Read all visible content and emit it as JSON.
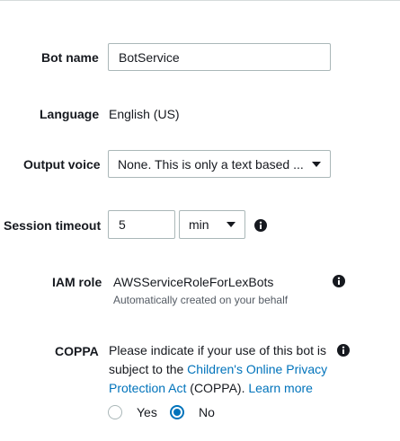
{
  "form": {
    "bot_name": {
      "label": "Bot name",
      "value": "BotService"
    },
    "language": {
      "label": "Language",
      "value": "English (US)"
    },
    "output_voice": {
      "label": "Output voice",
      "value": "None. This is only a text based ..."
    },
    "session_timeout": {
      "label": "Session timeout",
      "value": "5",
      "unit": "min"
    },
    "iam_role": {
      "label": "IAM role",
      "value": "AWSServiceRoleForLexBots",
      "sub": "Automatically created on your behalf"
    },
    "coppa": {
      "label": "COPPA",
      "text_1": "Please indicate if your use of this bot is subject to the ",
      "link_act": "Children's Online Privacy Protection Act",
      "text_2": " (COPPA). ",
      "link_learn": "Learn more",
      "yes_label": "Yes",
      "no_label": "No",
      "selected": "No"
    }
  },
  "icons": {
    "info": "info-icon",
    "caret": "chevron-down-icon"
  },
  "colors": {
    "link": "#0073bb",
    "border": "#aab7b8",
    "text": "#16191f"
  }
}
